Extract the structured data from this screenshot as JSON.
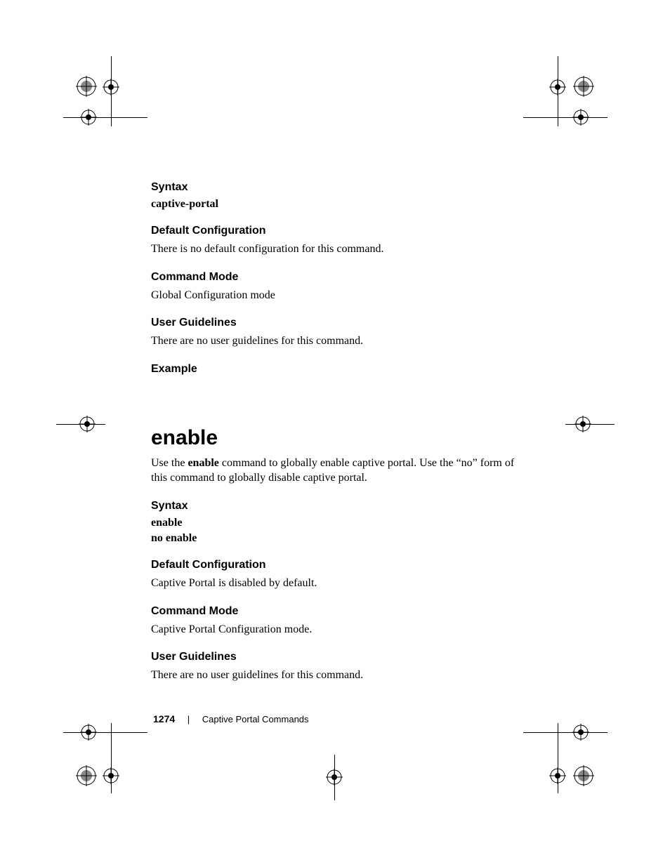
{
  "s1": {
    "syntax_head": "Syntax",
    "syntax_cmd": "captive-portal",
    "defcfg_head": "Default Configuration",
    "defcfg_text": "There is no default configuration for this command.",
    "cmdmode_head": "Command Mode",
    "cmdmode_text": "Global Configuration mode",
    "userg_head": "User Guidelines",
    "userg_text": "There are no user guidelines for this command.",
    "example_head": "Example"
  },
  "s2": {
    "title": "enable",
    "desc_pre": "Use the ",
    "desc_bold": "enable",
    "desc_post": " command to globally enable captive portal. Use the “no” form of this command to globally disable captive portal.",
    "syntax_head": "Syntax",
    "syntax_cmd1": "enable",
    "syntax_cmd2": "no enable",
    "defcfg_head": "Default Configuration",
    "defcfg_text": "Captive Portal is disabled by default.",
    "cmdmode_head": "Command Mode",
    "cmdmode_text": "Captive Portal Configuration mode.",
    "userg_head": "User Guidelines",
    "userg_text": "There are no user guidelines for this command."
  },
  "footer": {
    "page": "1274",
    "sep": "|",
    "section": "Captive Portal Commands"
  }
}
